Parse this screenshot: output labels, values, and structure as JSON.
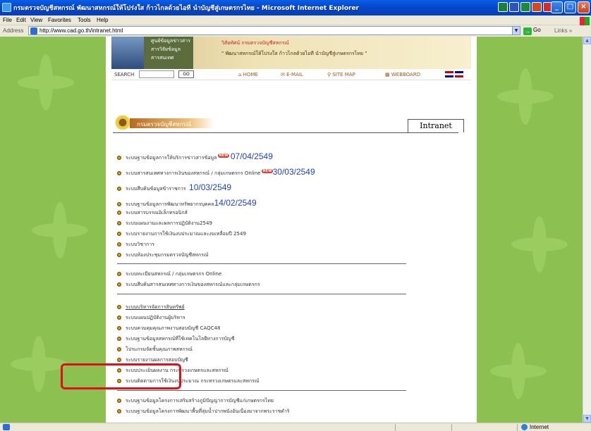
{
  "window": {
    "title": "กรมตรวจบัญชีสหกรณ์ พัฒนาสหกรณ์ให้โปร่งใส ก้าวไกลด้วยไอที นำบัญชีสู่เกษตรกรไทย - Microsoft Internet Explorer"
  },
  "menu": [
    "File",
    "Edit",
    "View",
    "Favorites",
    "Tools",
    "Help"
  ],
  "address": {
    "label": "Address",
    "url": "http://www.cad.go.th/intranet.html",
    "go": "Go",
    "links": "Links »"
  },
  "banner": {
    "menu1": "ศูนย์ข้อมูลข่าวสาร",
    "menu2": "สารวิจัยข้อมูล",
    "menu3": "สารสนเทศ",
    "line1": "วิสัยทัศน์ กรมตรวจบัญชีสหกรณ์",
    "line2": "\" พัฒนาสหกรณ์ให้โปร่งใส ก้าวไกลด้วยไอที นำบัญชีสู่เกษตรกรไทย \""
  },
  "nav": {
    "search_label": "SEARCH",
    "go": "GO",
    "home": "HOME",
    "email": "E-MAIL",
    "sitemap": "SITE MAP",
    "webboard": "WEBBOARD"
  },
  "header": {
    "title": "กรมตรวจบัญชีสหกรณ์",
    "tab": "Intranet"
  },
  "items": [
    {
      "text": "ระบบฐานข้อมูลการให้บริการข่าวสารข้อมูล",
      "new": "NEW",
      "date": "07/04/2549"
    },
    {
      "text": "ระบบสารสนเทศทางการเงินของสหกรณ์ / กลุ่มเกษตรกร Online",
      "new": "NEW",
      "date": "30/03/2549"
    },
    {
      "text": "ระบบสืบค้นข้อมูลข้าราชการ",
      "new": "",
      "date": "10/03/2549"
    },
    {
      "text": "ระบบฐานข้อมูลการพัฒนาทรัพยากรบุคคล",
      "new": "",
      "date": "14/02/2549"
    },
    {
      "text": "ระบบสารบรรณอิเล็กทรอนิกส์",
      "new": "",
      "date": ""
    },
    {
      "text": "ระบบแผนงานและผลการปฏิบัติงาน2549",
      "new": "",
      "date": ""
    },
    {
      "text": "ระบบรายงานการใช้เงินงบประมาณและงบเหลื่อมปี 2549",
      "new": "",
      "date": ""
    },
    {
      "text": "ระบบวิชาการ",
      "new": "",
      "date": ""
    },
    {
      "text": "ระบบห้องประชุมกรมตรวจบัญชีสหกรณ์",
      "new": "",
      "date": ""
    },
    {
      "text": "ระบบทะเบียนสหกรณ์ / กลุ่มเกษตรกร Online",
      "new": "",
      "date": ""
    },
    {
      "text": "ระบบสืบค้นสารสนเทศทางการเงินของสหกรณ์และกลุ่มเกษตรกร",
      "new": "",
      "date": ""
    },
    {
      "text": "ระบบบริหารจัดการสินทรัพย์",
      "new": "",
      "date": ""
    },
    {
      "text": "ระบบแผนปฏิบัติงานผู้บริหาร",
      "new": "",
      "date": ""
    },
    {
      "text": "ระบบควบคุมคุณภาพงานสอบบัญชี CAQC48",
      "new": "",
      "date": ""
    },
    {
      "text": "ระบบฐานข้อมูลสหกรณ์ที่ใช้เทคโนโลยีทางการบัญชี",
      "new": "",
      "date": ""
    },
    {
      "text": "โปรแกรมจัดชั้นคุณภาพสหกรณ์",
      "new": "",
      "date": ""
    },
    {
      "text": "ระบบรายงานผลการสอบบัญชี",
      "new": "",
      "date": ""
    },
    {
      "text": "ระบบประเมินผลงาน กระทรวงเกษตรและสหกรณ์",
      "new": "",
      "date": ""
    },
    {
      "text": "ระบบติดตามการใช้เงินงบประมาณ กระทรวงเกษตรและสหกรณ์",
      "new": "",
      "date": ""
    },
    {
      "text": "ระบบฐานข้อมูลโครงการเสริมสร้างภูมิปัญญาการบัญชีแก่เกษตรกรไทย",
      "new": "",
      "date": ""
    },
    {
      "text": "ระบบฐานข้อมูลโครงการพัฒนาพื้นที่ลุ่มน้ำปากพนังอันเนื่องมาจากพระราชดำริ",
      "new": "",
      "date": ""
    }
  ],
  "status": {
    "zone": "Internet"
  }
}
